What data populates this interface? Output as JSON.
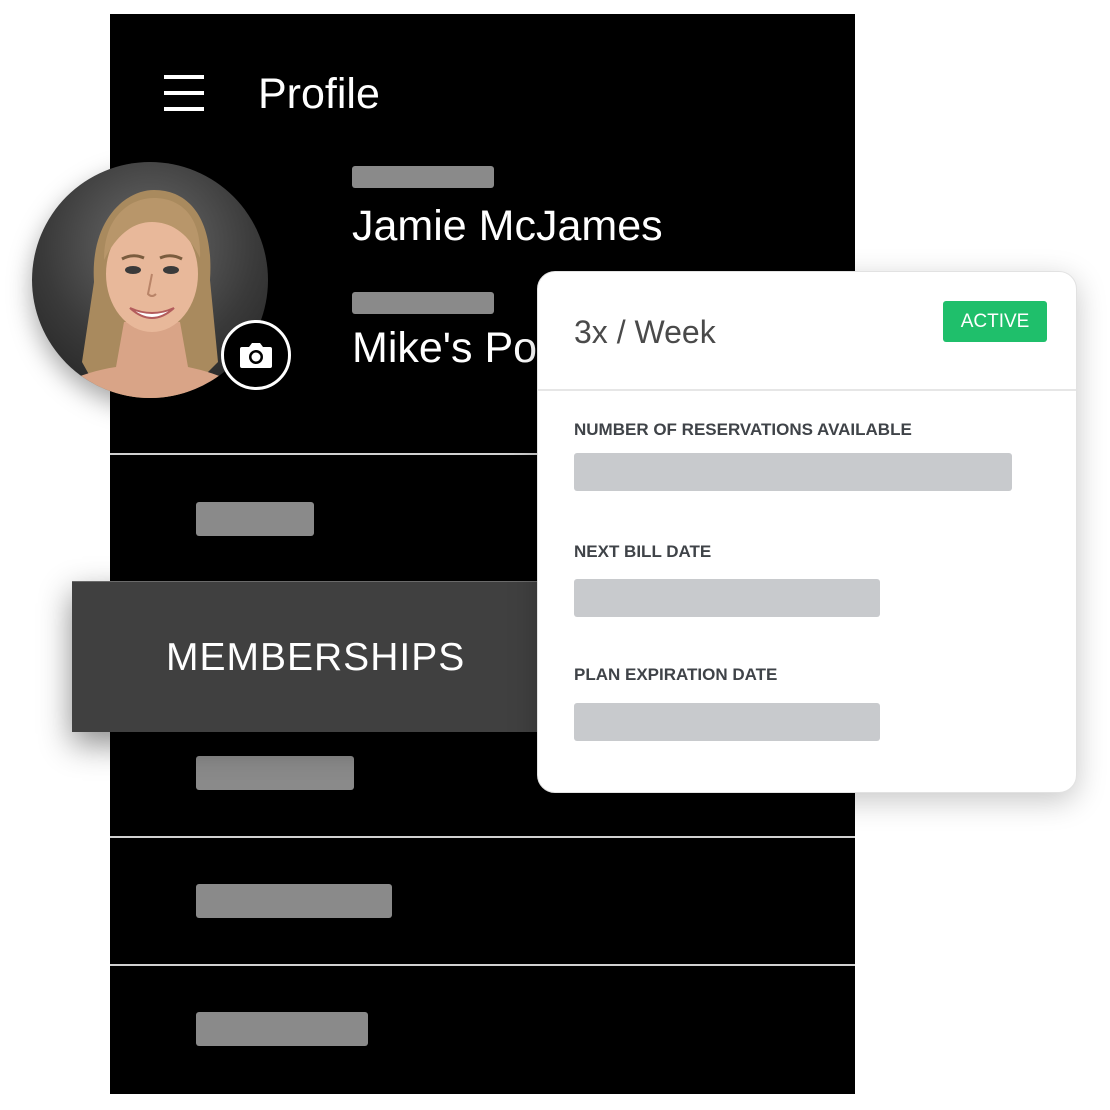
{
  "header": {
    "title": "Profile",
    "menu_icon": "hamburger-icon"
  },
  "profile": {
    "name": "Jamie McJames",
    "gym": "Mike's Pov",
    "camera_icon": "camera-icon"
  },
  "menu": {
    "active_item_label": "MEMBERSHIPS"
  },
  "membership_card": {
    "plan": "3x / Week",
    "status": "ACTIVE",
    "status_color": "#1fbf6b",
    "fields": [
      {
        "label": "NUMBER OF RESERVATIONS AVAILABLE"
      },
      {
        "label": "NEXT BILL DATE"
      },
      {
        "label": "PLAN EXPIRATION DATE"
      }
    ]
  }
}
